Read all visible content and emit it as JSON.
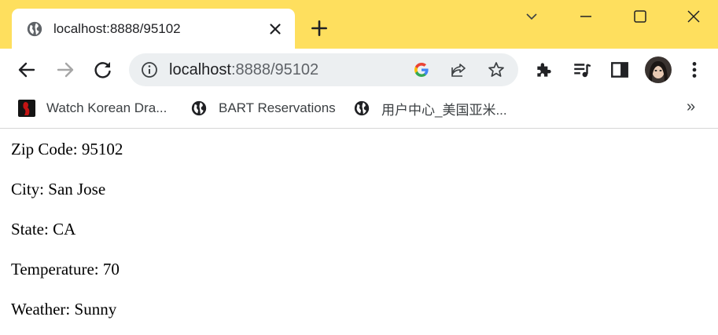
{
  "browser": {
    "tab": {
      "title": "localhost:8888/95102"
    },
    "address_bar": {
      "host": "localhost",
      "path": ":8888/95102"
    },
    "bookmarks": [
      {
        "label": "Watch Korean Dra...",
        "icon": "drama-site-icon"
      },
      {
        "label": "BART Reservations",
        "icon": "globe-icon"
      },
      {
        "label": "用户中心_美国亚米...",
        "icon": "globe-icon"
      }
    ],
    "bookmarks_more": "»",
    "colors": {
      "titlebar": "#fedf5e",
      "omnibox": "#eceff1"
    }
  },
  "page": {
    "zip": "Zip Code: 95102",
    "city": "City: San Jose",
    "state": "State: CA",
    "temperature": "Temperature: 70",
    "weather": "Weather: Sunny"
  }
}
